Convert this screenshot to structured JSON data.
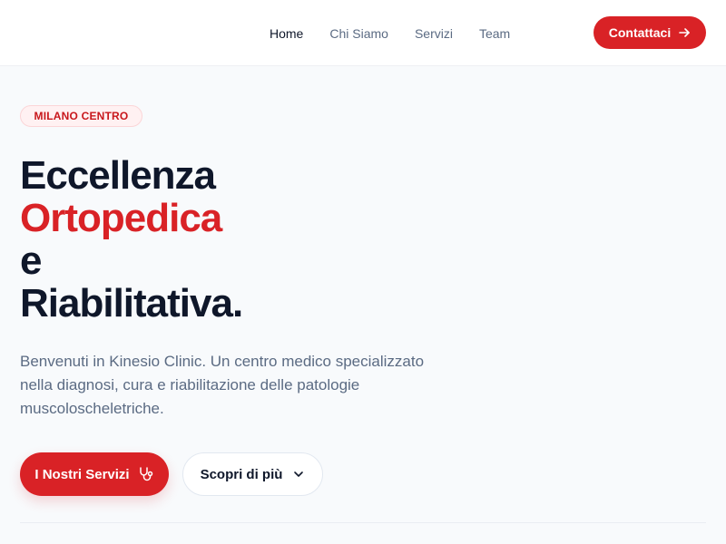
{
  "colors": {
    "accent": "#d92226",
    "text_dark": "#0f172a",
    "text_muted": "#5b6b83"
  },
  "nav": {
    "items": [
      {
        "label": "Home",
        "active": true
      },
      {
        "label": "Chi Siamo",
        "active": false
      },
      {
        "label": "Servizi",
        "active": false
      },
      {
        "label": "Team",
        "active": false
      }
    ],
    "cta_label": "Contattaci",
    "cta_icon": "arrow-right-icon"
  },
  "hero": {
    "badge": "MILANO CENTRO",
    "title_lines": [
      "Eccellenza",
      "Ortopedica",
      "e",
      "Riabilitativa."
    ],
    "description": "Benvenuti in Kinesio Clinic. Un centro medico specializzato nella diagnosi, cura e riabilitazione delle patologie muscoloscheletriche.",
    "primary_button": {
      "label": "I Nostri Servizi",
      "icon": "stethoscope-icon"
    },
    "secondary_button": {
      "label": "Scopri di più",
      "icon": "chevron-down-icon"
    }
  }
}
